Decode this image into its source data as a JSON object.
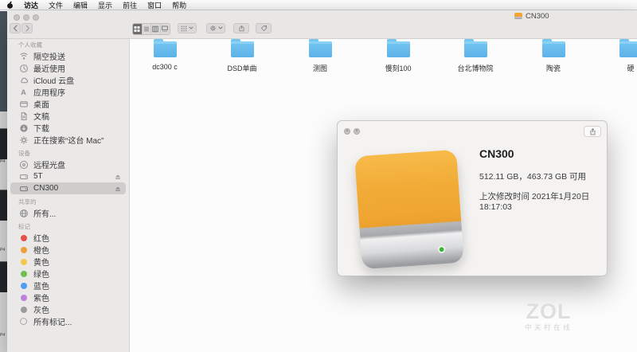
{
  "menu_bar": {
    "items": [
      "访达",
      "文件",
      "编辑",
      "显示",
      "前往",
      "窗口",
      "帮助"
    ]
  },
  "finder": {
    "title": "CN300",
    "sidebar": {
      "headers": {
        "favorites": "个人收藏",
        "devices": "设备",
        "shared": "共享的",
        "tags": "标记"
      },
      "favorites": [
        {
          "label": "隔空投送",
          "icon": "airdrop-icon"
        },
        {
          "label": "最近使用",
          "icon": "recents-clock-icon"
        },
        {
          "label": "iCloud 云盘",
          "icon": "cloud-icon"
        },
        {
          "label": "应用程序",
          "icon": "applications-icon"
        },
        {
          "label": "桌面",
          "icon": "desktop-icon"
        },
        {
          "label": "文稿",
          "icon": "documents-icon"
        },
        {
          "label": "下载",
          "icon": "downloads-icon"
        },
        {
          "label": "正在搜索“这台 Mac”",
          "icon": "smart-search-gear-icon"
        }
      ],
      "devices": [
        {
          "label": "远程光盘",
          "icon": "optical-disc-icon"
        },
        {
          "label": "5T",
          "icon": "external-drive-icon"
        },
        {
          "label": "CN300",
          "icon": "external-drive-icon"
        }
      ],
      "shared": [
        {
          "label": "所有...",
          "icon": "network-globe-icon"
        }
      ],
      "tags": [
        {
          "label": "红色",
          "color": "#e4504a"
        },
        {
          "label": "橙色",
          "color": "#eda03c"
        },
        {
          "label": "黄色",
          "color": "#f2c94c"
        },
        {
          "label": "绿色",
          "color": "#6fc14e"
        },
        {
          "label": "蓝色",
          "color": "#4f9ef3"
        },
        {
          "label": "紫色",
          "color": "#bd7ede"
        },
        {
          "label": "灰色",
          "color": "#9b9b9b"
        },
        {
          "label": "所有标记...",
          "color": "none"
        }
      ]
    },
    "folders": [
      "dc300 c",
      "DSD单曲",
      "测图",
      "慢刻100",
      "台北博物院",
      "陶瓷",
      "硬"
    ]
  },
  "info_window": {
    "title": "CN300",
    "capacity_line": "512.11 GB，463.73 GB 可用",
    "modified_line": "上次修改时间 2021年1月20日 18:17:03"
  },
  "watermark": {
    "logo": "ZOL",
    "caption": "中关村在线"
  },
  "desktop_fragments": {
    "file_label": "P4"
  },
  "colors": {
    "folder_blue": "#5cb2e8",
    "drive_orange": "#efa430",
    "drive_led_green": "#3db63c",
    "sidebar_selected": "#cfcdcb"
  }
}
